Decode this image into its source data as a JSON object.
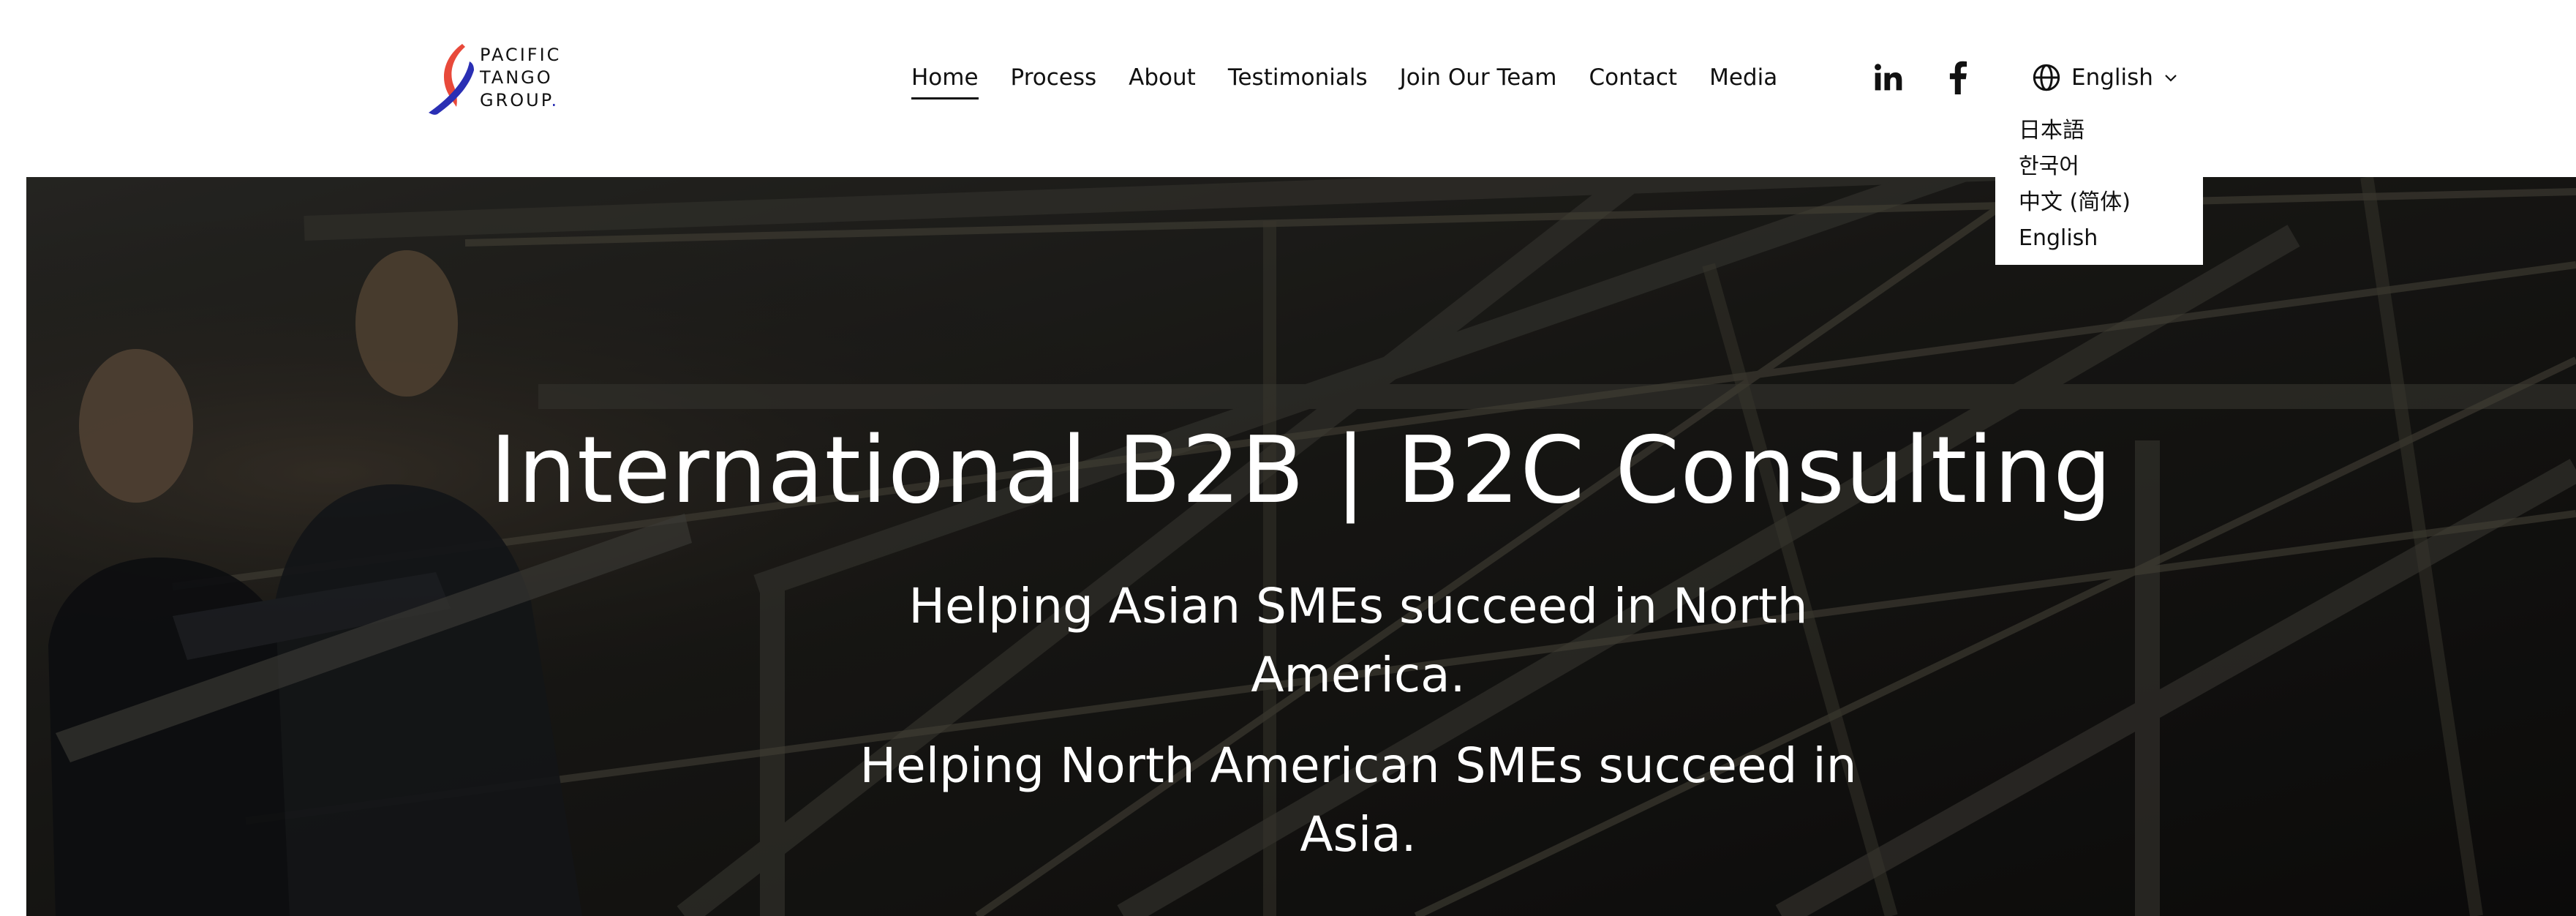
{
  "brand": {
    "line1": "PACIFIC",
    "line2": "TANGO",
    "line3": "GROUP",
    "dot": ".",
    "colors": {
      "red": "#e8493a",
      "blue": "#2a2fb4"
    }
  },
  "nav": {
    "items": [
      {
        "label": "Home",
        "active": true
      },
      {
        "label": "Process"
      },
      {
        "label": "About"
      },
      {
        "label": "Testimonials"
      },
      {
        "label": "Join Our Team"
      },
      {
        "label": "Contact"
      },
      {
        "label": "Media"
      }
    ]
  },
  "social": {
    "linkedin_icon": "linkedin-icon",
    "facebook_icon": "facebook-icon"
  },
  "language": {
    "icon": "globe-icon",
    "selected": "English",
    "chevron": "chevron-down-icon",
    "options": [
      "日本語",
      "한국어",
      "中文 (简体)",
      "English"
    ]
  },
  "hero": {
    "title": "International B2B | B2C Consulting",
    "subtitle1": "Helping Asian SMEs succeed in North America.",
    "subtitle2": "Helping North American SMEs succeed in Asia."
  }
}
